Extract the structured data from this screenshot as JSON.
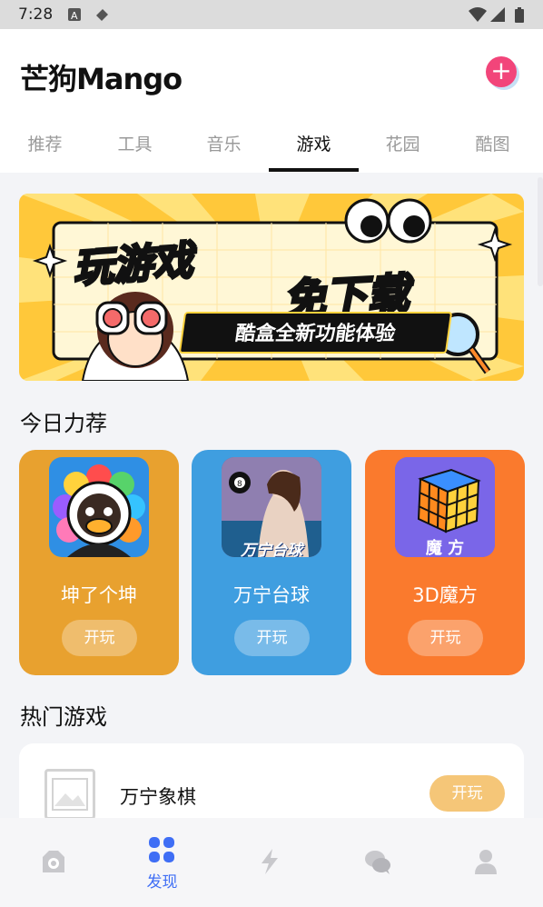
{
  "status_bar": {
    "time": "7:28"
  },
  "header": {
    "logo": "芒狗Mango",
    "add_label": "+"
  },
  "tabs": [
    {
      "label": "推荐",
      "active": false
    },
    {
      "label": "工具",
      "active": false
    },
    {
      "label": "音乐",
      "active": false
    },
    {
      "label": "游戏",
      "active": true
    },
    {
      "label": "花园",
      "active": false
    },
    {
      "label": "酷图",
      "active": false
    }
  ],
  "banner": {
    "title_1": "玩游戏",
    "title_2": "免下载",
    "subtitle": "酷盒全新功能体验"
  },
  "today_section": {
    "title": "今日力荐",
    "cards": [
      {
        "name": "坤了个坤",
        "play_label": "开玩",
        "color": "#e8a12f"
      },
      {
        "name": "万宁台球",
        "play_label": "开玩",
        "color": "#3f9ee0"
      },
      {
        "name": "3D魔方",
        "play_label": "开玩",
        "color": "#fa7a2d"
      }
    ],
    "card_image_texts": [
      "万宁台球",
      "魔 方"
    ]
  },
  "hot_section": {
    "title": "热门游戏",
    "items": [
      {
        "name": "万宁象棋",
        "play_label": "开玩"
      }
    ]
  },
  "bottom_nav": {
    "items": [
      {
        "icon": "camera-icon",
        "label": ""
      },
      {
        "icon": "grid-icon",
        "label": "发现",
        "active": true
      },
      {
        "icon": "lightning-icon",
        "label": ""
      },
      {
        "icon": "chat-icon",
        "label": ""
      },
      {
        "icon": "person-icon",
        "label": ""
      }
    ]
  },
  "colors": {
    "accent": "#3f6ef5",
    "add_button": "#f2457a",
    "banner_bg": "#ffc83a"
  }
}
